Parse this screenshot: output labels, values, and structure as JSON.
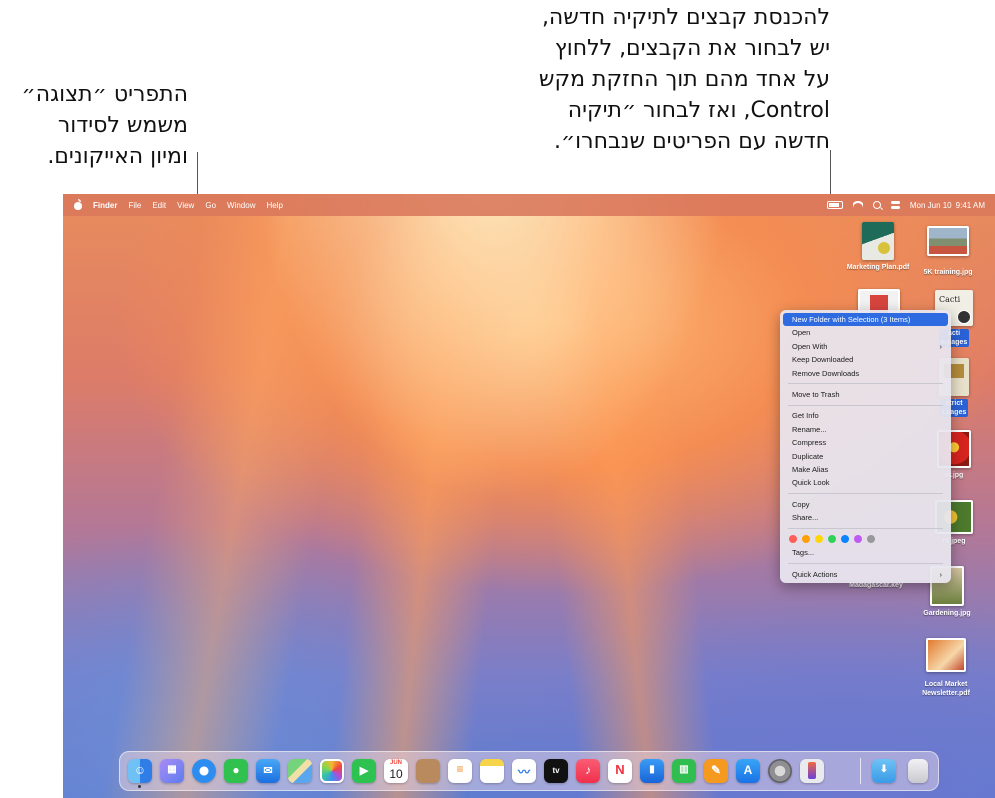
{
  "callouts": {
    "left": "התפריט ״תצוגה״\nמשמש לסידור\nומיון האייקונים.",
    "center": "להכנסת קבצים לתיקיה חדשה,\nיש לבחור את הקבצים, ללחוץ\nעל אחד מהם תוך החזקת מקש\nControl, ואז לבחור ״תיקיה\nחדשה עם הפריטים שנבחרו״."
  },
  "menubar": {
    "items": [
      "Finder",
      "File",
      "Edit",
      "View",
      "Go",
      "Window",
      "Help"
    ],
    "date": "Mon Jun 10",
    "time": "9:41 AM"
  },
  "desktop_icons": [
    {
      "name": "Marketing Plan.pdf"
    },
    {
      "name": "5K training.jpg"
    },
    {
      "name": "acti\nn.pages"
    },
    {
      "name": "strict\nt.pages"
    },
    {
      "name": "er.jpg"
    },
    {
      "name": "rs.jpeg"
    },
    {
      "name": "Madagascar.key"
    },
    {
      "name": "Gardening.jpg"
    },
    {
      "name": "Local Market\nNewsletter.pdf"
    }
  ],
  "context_menu": {
    "items": [
      "New Folder with Selection (3 Items)",
      "Open",
      "Open With",
      "Keep Downloaded",
      "Remove Downloads",
      "Move to Trash",
      "Get Info",
      "Rename...",
      "Compress",
      "Duplicate",
      "Make Alias",
      "Quick Look",
      "Copy",
      "Share...",
      "Tags...",
      "Quick Actions"
    ],
    "tag_colors": [
      "#ff5f57",
      "#ff9f0a",
      "#ffd60a",
      "#30d158",
      "#0a84ff",
      "#bf5af2",
      "#98989d"
    ]
  },
  "dock": {
    "calendar_month": "JUN",
    "calendar_day": "10",
    "tv_label": "tv",
    "apps": [
      "finder",
      "launchpad",
      "safari",
      "messages",
      "mail",
      "maps",
      "photos",
      "facetime",
      "calendar",
      "contacts",
      "reminders",
      "notes",
      "freeform",
      "tv",
      "music",
      "news",
      "keynote",
      "numbers",
      "pages",
      "app-store",
      "system-settings",
      "iphone-mirroring",
      "downloads",
      "trash"
    ]
  }
}
